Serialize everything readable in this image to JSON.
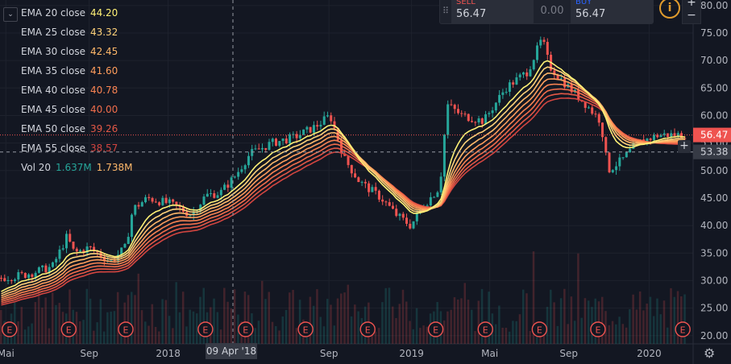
{
  "chart_data": {
    "type": "candlestick",
    "x_ticks": [
      "Mai",
      "Sep",
      "2018",
      "Sep",
      "2019",
      "Mai",
      "Sep",
      "2020"
    ],
    "y_ticks": [
      20,
      25,
      30,
      35,
      40,
      45,
      50,
      55,
      60,
      65,
      70,
      75,
      80
    ],
    "ylim": [
      18.5,
      81
    ],
    "price_labels": {
      "last": "56.47",
      "crosshair": "53.38"
    },
    "crosshair_date": "09 Apr '18",
    "indicators": [
      {
        "name": "EMA 20 close",
        "value": "44.20",
        "color": "#fff176"
      },
      {
        "name": "EMA 25 close",
        "value": "43.32",
        "color": "#ffd27a"
      },
      {
        "name": "EMA 30 close",
        "value": "42.45",
        "color": "#ffb86a"
      },
      {
        "name": "EMA 35 close",
        "value": "41.60",
        "color": "#ff9d5c"
      },
      {
        "name": "EMA 40 close",
        "value": "40.78",
        "color": "#f98352"
      },
      {
        "name": "EMA 45 close",
        "value": "40.00",
        "color": "#f06d4b"
      },
      {
        "name": "EMA 50 close",
        "value": "39.26",
        "color": "#e35846"
      },
      {
        "name": "EMA 55 close",
        "value": "38.57",
        "color": "#d24540"
      }
    ],
    "volume": {
      "name": "Vol 20",
      "value1": "1.637M",
      "value2": "1.738M"
    },
    "earnings_marker": "E",
    "earnings_positions": [
      0.013,
      0.094,
      0.172,
      0.281,
      0.336,
      0.418,
      0.503,
      0.596,
      0.664,
      0.738,
      0.818,
      0.934
    ],
    "price_path": [
      [
        0,
        30.5
      ],
      [
        0.03,
        31
      ],
      [
        0.07,
        32.5
      ],
      [
        0.09,
        38
      ],
      [
        0.1,
        35
      ],
      [
        0.12,
        36
      ],
      [
        0.15,
        33.5
      ],
      [
        0.17,
        36
      ],
      [
        0.18,
        43
      ],
      [
        0.2,
        45
      ],
      [
        0.23,
        44
      ],
      [
        0.26,
        42
      ],
      [
        0.28,
        45.5
      ],
      [
        0.3,
        46
      ],
      [
        0.32,
        49
      ],
      [
        0.34,
        53
      ],
      [
        0.37,
        55
      ],
      [
        0.4,
        56
      ],
      [
        0.43,
        58
      ],
      [
        0.45,
        60
      ],
      [
        0.47,
        52
      ],
      [
        0.49,
        48
      ],
      [
        0.52,
        45
      ],
      [
        0.54,
        42
      ],
      [
        0.56,
        40
      ],
      [
        0.58,
        44
      ],
      [
        0.6,
        47
      ],
      [
        0.61,
        62
      ],
      [
        0.63,
        60
      ],
      [
        0.66,
        59
      ],
      [
        0.69,
        65
      ],
      [
        0.72,
        68
      ],
      [
        0.74,
        74
      ],
      [
        0.75,
        69
      ],
      [
        0.77,
        66
      ],
      [
        0.8,
        62
      ],
      [
        0.82,
        59
      ],
      [
        0.83,
        50
      ],
      [
        0.85,
        52
      ],
      [
        0.87,
        55
      ],
      [
        0.9,
        56.5
      ],
      [
        0.94,
        56.5
      ]
    ]
  },
  "trade": {
    "sell_label": "SELL",
    "sell_value": "56.47",
    "spread": "0.00",
    "buy_label": "BUY",
    "buy_value": "56.47"
  },
  "colors": {
    "up": "#26a69a",
    "down": "#ef5350",
    "bg": "#131722",
    "grid": "#1e222d",
    "text": "#b2b5be"
  }
}
